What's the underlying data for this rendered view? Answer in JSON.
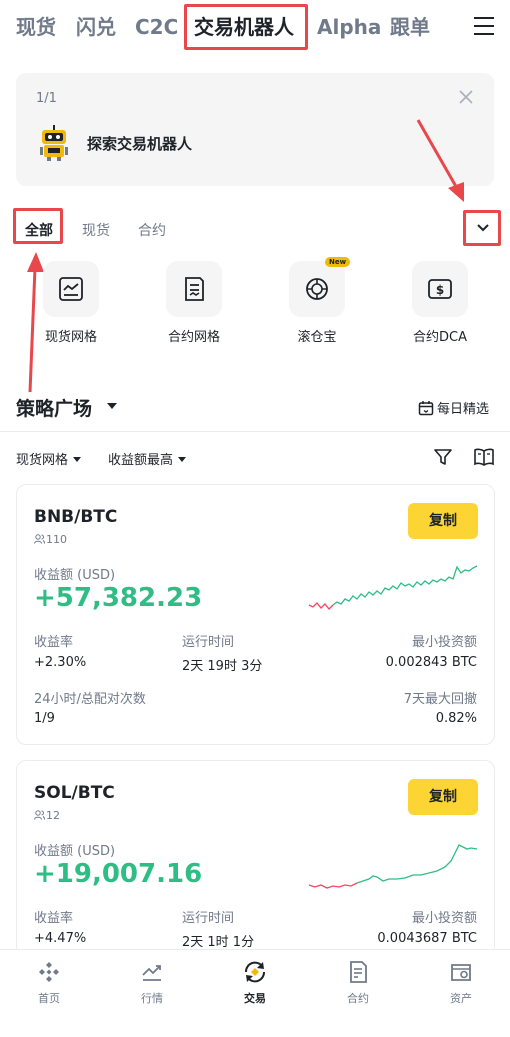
{
  "top_tabs": [
    {
      "label": "现货",
      "active": false
    },
    {
      "label": "闪兑",
      "active": false
    },
    {
      "label": "C2C",
      "active": false
    },
    {
      "label": "交易机器人",
      "active": true
    },
    {
      "label": "Alpha",
      "active": false
    },
    {
      "label": "跟单",
      "active": false
    }
  ],
  "banner": {
    "page_indicator": "1/1",
    "title": "探索交易机器人"
  },
  "category_tabs": [
    {
      "label": "全部",
      "active": true
    },
    {
      "label": "现货",
      "active": false
    },
    {
      "label": "合约",
      "active": false
    }
  ],
  "tools": [
    {
      "label": "现货网格",
      "icon": "spot-grid-icon"
    },
    {
      "label": "合约网格",
      "icon": "futures-grid-icon"
    },
    {
      "label": "滚仓宝",
      "icon": "roll-position-icon",
      "badge": "New"
    },
    {
      "label": "合约DCA",
      "icon": "futures-dca-icon"
    }
  ],
  "strategy": {
    "title": "策略广场",
    "daily_pick": "每日精选",
    "filter_type": "现货网格",
    "filter_sort": "收益额最高"
  },
  "cards": [
    {
      "pair": "BNB/BTC",
      "users": "110",
      "copy_label": "复制",
      "profit_label": "收益额 (USD)",
      "profit": "+57,382.23",
      "roi_label": "收益率",
      "roi": "+2.30%",
      "runtime_label": "运行时间",
      "runtime": "2天 19时 3分",
      "min_invest_label": "最小投资额",
      "min_invest": "0.002843 BTC",
      "matches_label": "24小时/总配对次数",
      "matches": "1/9",
      "drawdown_label": "7天最大回撤",
      "drawdown": "0.82%"
    },
    {
      "pair": "SOL/BTC",
      "users": "12",
      "copy_label": "复制",
      "profit_label": "收益额 (USD)",
      "profit": "+19,007.16",
      "roi_label": "收益率",
      "roi": "+4.47%",
      "runtime_label": "运行时间",
      "runtime": "2天 1时 1分",
      "min_invest_label": "最小投资额",
      "min_invest": "0.0043687 BTC"
    }
  ],
  "bottom_nav": [
    {
      "label": "首页",
      "icon": "home-icon",
      "active": false
    },
    {
      "label": "行情",
      "icon": "markets-icon",
      "active": false
    },
    {
      "label": "交易",
      "icon": "trade-icon",
      "active": true
    },
    {
      "label": "合约",
      "icon": "futures-icon",
      "active": false
    },
    {
      "label": "资产",
      "icon": "wallet-icon",
      "active": false
    }
  ],
  "colors": {
    "accent_yellow": "#fcd535",
    "profit_green": "#2ebd85",
    "loss_red": "#f6465d",
    "highlight_red": "#e8474c",
    "text_primary": "#1e2329",
    "text_secondary": "#707a8a"
  }
}
